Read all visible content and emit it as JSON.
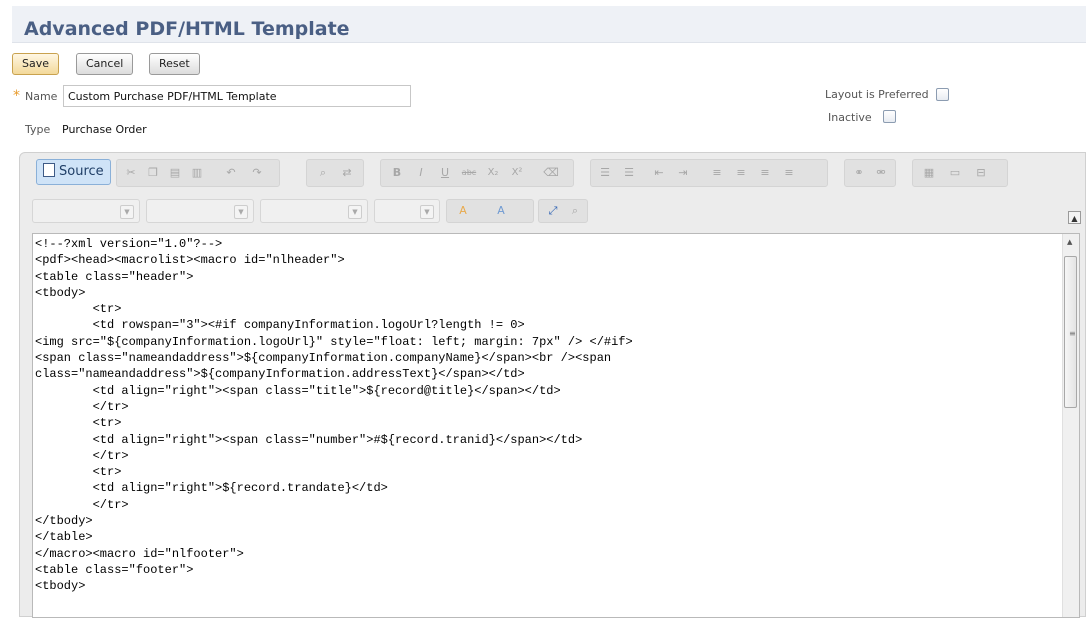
{
  "header": {
    "title": "Advanced PDF/HTML Template"
  },
  "buttons": {
    "save": "Save",
    "cancel": "Cancel",
    "reset": "Reset"
  },
  "form": {
    "required_mark": "*",
    "name_label": "Name",
    "name_value": "Custom Purchase PDF/HTML Template",
    "type_label": "Type",
    "type_value": "Purchase Order",
    "layout_preferred_label": "Layout is Preferred",
    "layout_preferred_checked": false,
    "inactive_label": "Inactive",
    "inactive_checked": false
  },
  "editor": {
    "source_label": "Source",
    "toolbar_icons": [
      "cut-icon",
      "copy-icon",
      "paste-icon",
      "paste-text-icon",
      "undo-icon",
      "redo-icon",
      "find-icon",
      "replace-icon",
      "bold-icon",
      "italic-icon",
      "underline-icon",
      "strike-icon",
      "subscript-icon",
      "superscript-icon",
      "remove-format-icon",
      "numbered-list-icon",
      "bulleted-list-icon",
      "outdent-icon",
      "indent-icon",
      "align-left-icon",
      "align-center-icon",
      "align-right-icon",
      "justify-icon",
      "link-icon",
      "unlink-icon",
      "table-icon",
      "horizontal-rule-icon",
      "page-break-icon"
    ],
    "format_combos": [
      "",
      "",
      "",
      ""
    ],
    "code": "<!--?xml version=\"1.0\"?-->\n<pdf><head><macrolist><macro id=\"nlheader\">\n<table class=\"header\">\n<tbody>\n        <tr>\n        <td rowspan=\"3\"><#if companyInformation.logoUrl?length != 0>\n<img src=\"${companyInformation.logoUrl}\" style=\"float: left; margin: 7px\" /> </#if>\n<span class=\"nameandaddress\">${companyInformation.companyName}</span><br /><span\nclass=\"nameandaddress\">${companyInformation.addressText}</span></td>\n        <td align=\"right\"><span class=\"title\">${record@title}</span></td>\n        </tr>\n        <tr>\n        <td align=\"right\"><span class=\"number\">#${record.tranid}</span></td>\n        </tr>\n        <tr>\n        <td align=\"right\">${record.trandate}</td>\n        </tr>\n</tbody>\n</table>\n</macro><macro id=\"nlfooter\">\n<table class=\"footer\">\n<tbody>"
  }
}
